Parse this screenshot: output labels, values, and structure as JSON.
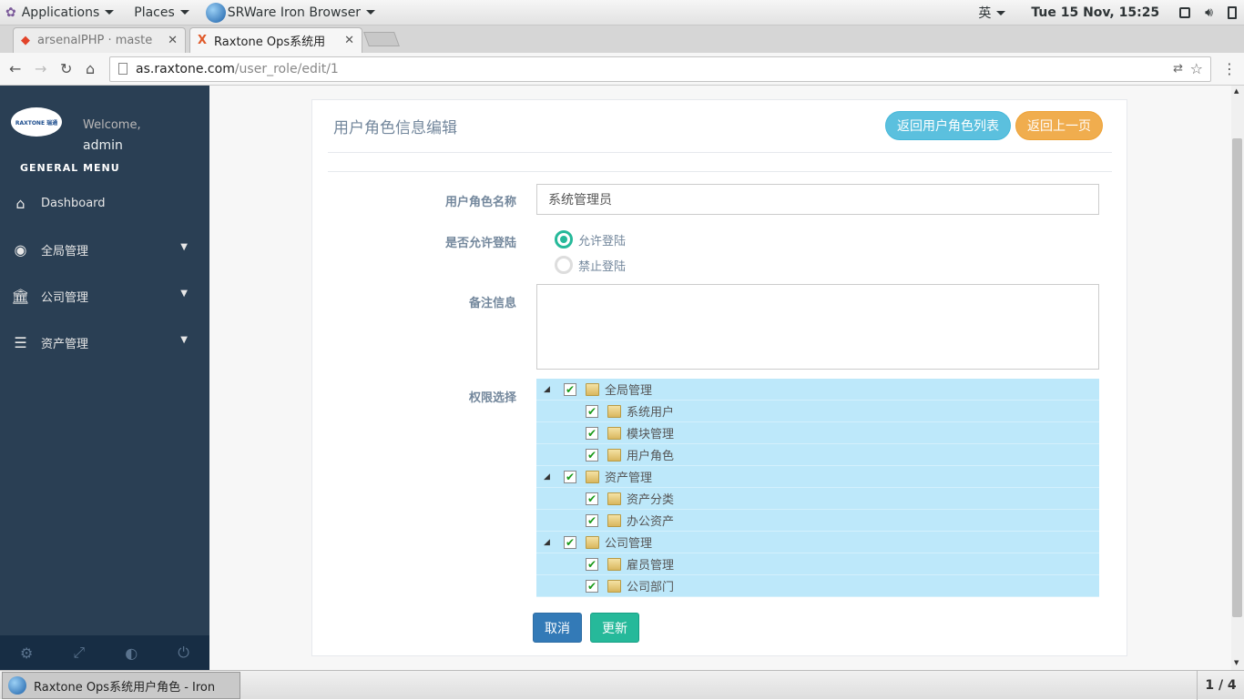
{
  "topbar": {
    "applications": "Applications",
    "places": "Places",
    "browser_app": "SRWare Iron Browser",
    "ime": "英",
    "clock": "Tue 15 Nov, 15:25"
  },
  "tabs": [
    {
      "title": "arsenalPHP · maste"
    },
    {
      "title": "Raxtone Ops系统用"
    }
  ],
  "address": {
    "host": "as.raxtone.com",
    "path": "/user_role/edit/1"
  },
  "sidebar": {
    "logo_text": "RAXTONE 瑞通",
    "welcome": "Welcome,",
    "username": "admin",
    "menu_heading": "GENERAL MENU",
    "items": [
      {
        "label": "Dashboard",
        "icon": "home-icon"
      },
      {
        "label": "全局管理",
        "icon": "globe-icon"
      },
      {
        "label": "公司管理",
        "icon": "bank-icon"
      },
      {
        "label": "资产管理",
        "icon": "list-icon"
      }
    ]
  },
  "panel": {
    "title": "用户角色信息编辑",
    "back_to_list": "返回用户角色列表",
    "back_prev": "返回上一页",
    "fields": {
      "name_label": "用户角色名称",
      "name_value": "系统管理员",
      "login_label": "是否允许登陆",
      "login_allow": "允许登陆",
      "login_deny": "禁止登陆",
      "login_selected": "允许登陆",
      "remark_label": "备注信息",
      "remark_value": "",
      "perm_label": "权限选择"
    },
    "tree": [
      {
        "label": "全局管理",
        "level": 0,
        "checked": true
      },
      {
        "label": "系统用户",
        "level": 1,
        "checked": true
      },
      {
        "label": "模块管理",
        "level": 1,
        "checked": true
      },
      {
        "label": "用户角色",
        "level": 1,
        "checked": true
      },
      {
        "label": "资产管理",
        "level": 0,
        "checked": true
      },
      {
        "label": "资产分类",
        "level": 1,
        "checked": true
      },
      {
        "label": "办公资产",
        "level": 1,
        "checked": true
      },
      {
        "label": "公司管理",
        "level": 0,
        "checked": true
      },
      {
        "label": "雇员管理",
        "level": 1,
        "checked": true
      },
      {
        "label": "公司部门",
        "level": 1,
        "checked": true
      }
    ],
    "cancel": "取消",
    "update": "更新"
  },
  "taskbar": {
    "window_title": "Raxtone Ops系统用户角色 - Iron",
    "workspace": "1 / 4"
  },
  "colors": {
    "sidebar": "#2a3f54",
    "info_btn": "#5bc0de",
    "warning_btn": "#f0ad4e",
    "primary_btn": "#337ab7",
    "success_btn": "#26B99A",
    "tree_bg": "#BDE8FA"
  }
}
